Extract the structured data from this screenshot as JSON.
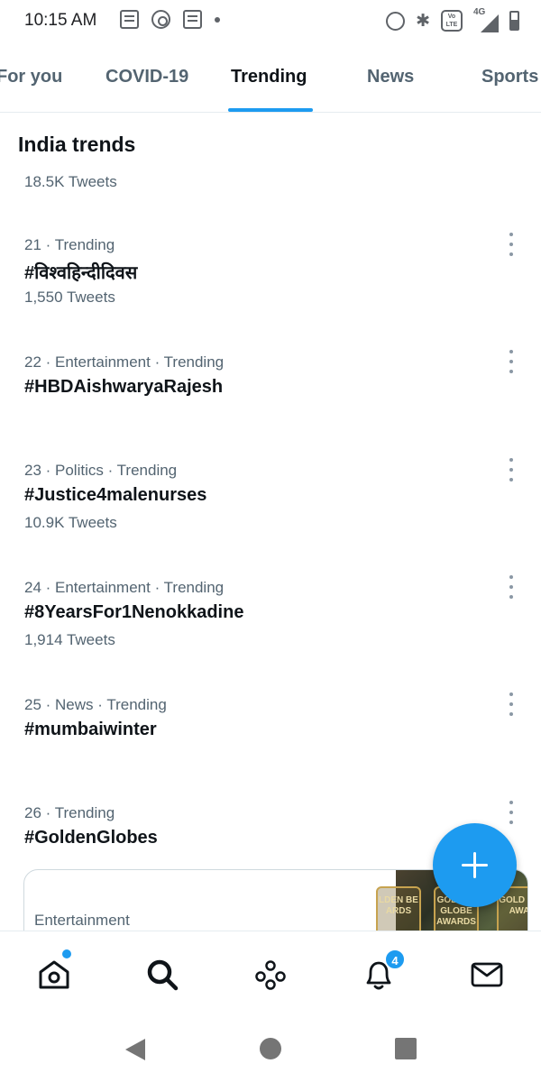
{
  "status_bar": {
    "time": "10:15 AM",
    "network_label": "4G",
    "volte_label": "Vo LTE",
    "icons": [
      "message-icon",
      "emblem-icon",
      "message-icon",
      "dot-icon",
      "alarm-icon",
      "bluetooth-icon",
      "volte-icon",
      "signal-icon",
      "battery-icon"
    ]
  },
  "tabs": [
    {
      "label": "For you",
      "active": false
    },
    {
      "label": "COVID-19",
      "active": false
    },
    {
      "label": "Trending",
      "active": true
    },
    {
      "label": "News",
      "active": false
    },
    {
      "label": "Sports",
      "active": false
    }
  ],
  "section_title": "India trends",
  "partial_previous_count": "18.5K Tweets",
  "trends": [
    {
      "meta": "21 · Trending",
      "name": "#विश्वहिन्दीदिवस",
      "count": "1,550 Tweets"
    },
    {
      "meta": "22 · Entertainment · Trending",
      "name": "#HBDAishwaryaRajesh",
      "count": ""
    },
    {
      "meta": "23 · Politics · Trending",
      "name": "#Justice4malenurses",
      "count": "10.9K Tweets"
    },
    {
      "meta": "24 · Entertainment · Trending",
      "name": "#8YearsFor1Nenokkadine",
      "count": "1,914 Tweets"
    },
    {
      "meta": "25 · News · Trending",
      "name": "#mumbaiwinter",
      "count": ""
    },
    {
      "meta": "26 · Trending",
      "name": "#GoldenGlobes",
      "count": ""
    }
  ],
  "card": {
    "label": "Entertainment",
    "image_text": [
      "LDEN BE ARDS",
      "GOLDEN GLOBE AWARDS",
      "GOLD GL AWA"
    ]
  },
  "fab_icon": "plus-icon",
  "bottom_nav": [
    {
      "icon": "home-icon",
      "has_dot": true
    },
    {
      "icon": "search-icon",
      "active": true
    },
    {
      "icon": "spaces-icon"
    },
    {
      "icon": "bell-icon",
      "badge": "4"
    },
    {
      "icon": "mail-icon"
    }
  ],
  "colors": {
    "accent": "#1d9bf0",
    "text_primary": "#0f1419",
    "text_secondary": "#536471"
  }
}
